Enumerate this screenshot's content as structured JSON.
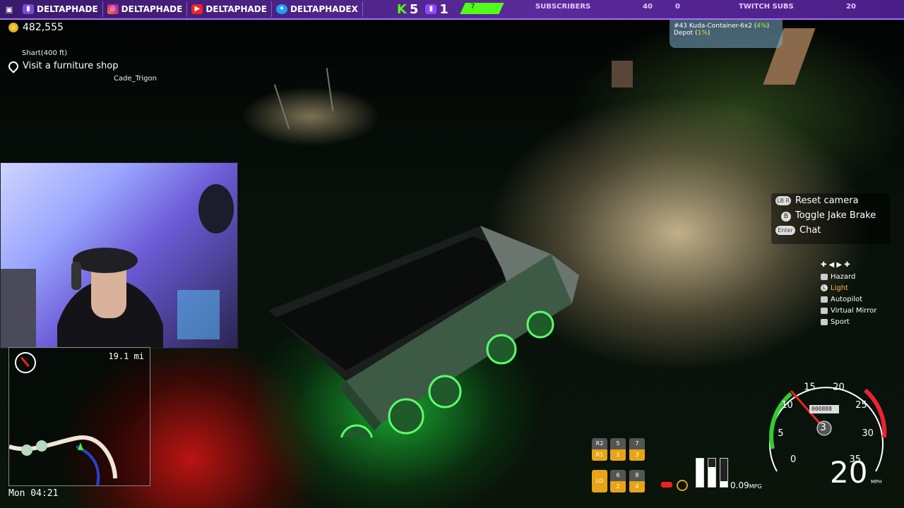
{
  "topbar": {
    "handles": [
      {
        "label": "DELTAPHADE",
        "icon": "twitch-icon"
      },
      {
        "label": "DELTAPHADE",
        "icon": "instagram-icon"
      },
      {
        "label": "DELTAPHADE",
        "icon": "youtube-icon"
      },
      {
        "label": "DELTAPHADEX",
        "icon": "twitter-icon"
      }
    ],
    "kick_count": "5",
    "twitch_count": "1",
    "sub_progress": "7",
    "subscribers_label": "SUBSCRIBERS",
    "subscribers_value": "40",
    "twitch_subs_left": "0",
    "twitch_subs_label": "TWITCH SUBS",
    "twitch_subs_value": "20"
  },
  "hud": {
    "money": "482,555",
    "location": "Shart(400 ft)",
    "mission": "Visit a furniture shop",
    "player_tag": "Cade_Trigon"
  },
  "cargo": {
    "line1_prefix": "#43 Kuda-Container-6x2 (",
    "line1_pct": "4%",
    "line1_suffix": ")",
    "line2_prefix": "Depot (",
    "line2_pct": "1%",
    "line2_suffix": ")"
  },
  "minimap": {
    "distance": "19.1 mi",
    "clock": "Mon 04:21"
  },
  "controls": [
    {
      "button": "LB R",
      "label": "Reset camera"
    },
    {
      "button": "B",
      "label": "Toggle Jake Brake"
    },
    {
      "button": "Enter",
      "label": "Chat"
    }
  ],
  "options": [
    {
      "label": "Hazard",
      "highlight": false
    },
    {
      "label": "Light",
      "highlight": true
    },
    {
      "label": "Autopilot",
      "highlight": false
    },
    {
      "label": "Virtual Mirror",
      "highlight": false
    },
    {
      "label": "Sport",
      "highlight": false
    }
  ],
  "gears": {
    "r2": "R2",
    "r1": "R1",
    "g5": "5",
    "g1": "1",
    "g7": "7",
    "g3": "3",
    "lo": "LO",
    "g6": "6",
    "g2": "2",
    "g8": "8",
    "g4": "4"
  },
  "gauge": {
    "ticks": [
      "0",
      "5",
      "10",
      "15",
      "20",
      "25",
      "30",
      "35"
    ],
    "odometer": "000888",
    "gear": "3",
    "speed": "20",
    "unit": "MPH",
    "mpg": "0.09",
    "mpg_unit": "MPG"
  },
  "colors": {
    "accent_purple": "#5b2a9a",
    "kick_green": "#53fc18",
    "light_orange": "#ffb733",
    "gear_yellow": "#e8a417"
  }
}
